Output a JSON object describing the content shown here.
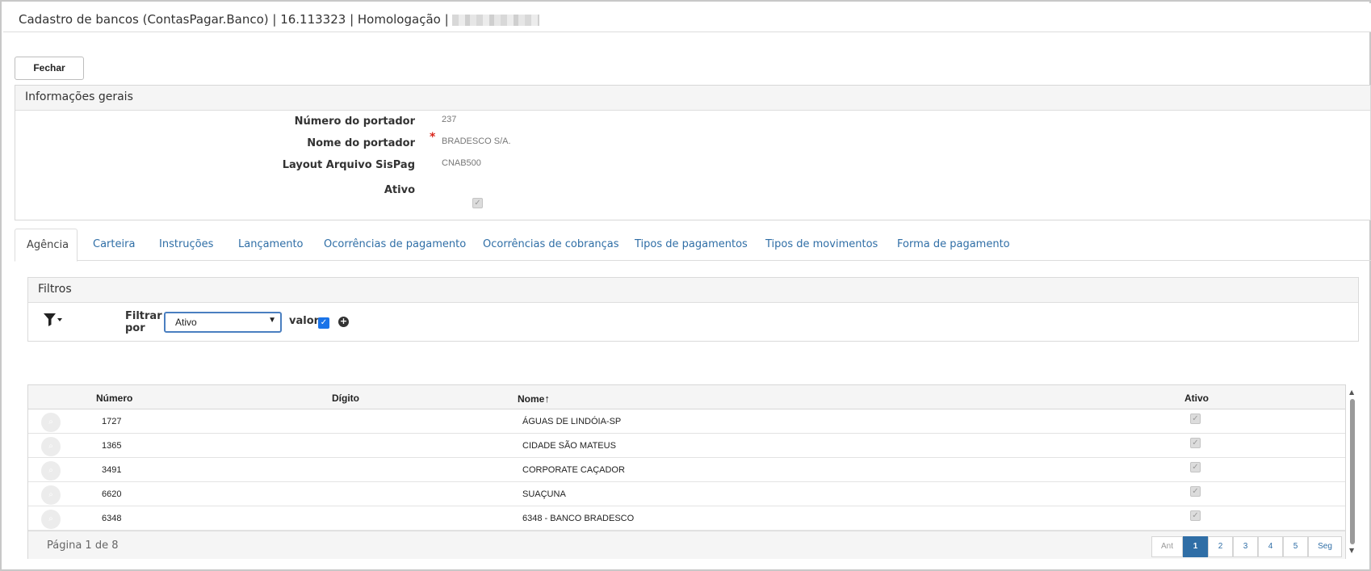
{
  "window": {
    "title": "Cadastro de bancos (ContasPagar.Banco) | 16.113323 | Homologação |"
  },
  "toolbar": {
    "close_label": "Fechar"
  },
  "general": {
    "header": "Informações gerais",
    "fields": {
      "numero_label": "Número do portador",
      "numero_value": "237",
      "nome_label": "Nome do portador",
      "nome_value": "BRADESCO S/A.",
      "layout_label": "Layout Arquivo SisPag",
      "layout_value": "CNAB500",
      "ativo_label": "Ativo",
      "ativo_checked": true
    },
    "required_mark": "*"
  },
  "tabs": [
    {
      "label": "Agência",
      "active": true
    },
    {
      "label": "Carteira"
    },
    {
      "label": "Instruções"
    },
    {
      "label": "Lançamento"
    },
    {
      "label": "Ocorrências de pagamento"
    },
    {
      "label": "Ocorrências de cobranças"
    },
    {
      "label": "Tipos de pagamentos"
    },
    {
      "label": "Tipos de movimentos"
    },
    {
      "label": "Forma de pagamento"
    }
  ],
  "filters": {
    "header": "Filtros",
    "filter_by_label": "Filtrar por",
    "selected_field": "Ativo",
    "value_label": "valor",
    "value_checked": true
  },
  "grid": {
    "columns": [
      "Número",
      "Dígito",
      "Nome",
      "Ativo"
    ],
    "sorted_column": "Nome",
    "sort_direction": "asc",
    "rows": [
      {
        "numero": "1727",
        "digito": "",
        "nome": "ÁGUAS DE LINDÓIA-SP",
        "ativo": true
      },
      {
        "numero": "1365",
        "digito": "",
        "nome": "CIDADE SÃO MATEUS",
        "ativo": true
      },
      {
        "numero": "3491",
        "digito": "",
        "nome": "CORPORATE CAÇADOR",
        "ativo": true
      },
      {
        "numero": "6620",
        "digito": "",
        "nome": "SUAÇUNA",
        "ativo": true
      },
      {
        "numero": "6348",
        "digito": "",
        "nome": "6348 - BANCO BRADESCO",
        "ativo": true
      }
    ]
  },
  "pagination": {
    "info": "Página 1 de 8",
    "prev": "Ant",
    "pages": [
      "1",
      "2",
      "3",
      "4",
      "5"
    ],
    "current": "1",
    "next": "Seg"
  },
  "colors": {
    "link": "#2f6ea6",
    "required": "#d9261c",
    "active_page": "#2f6ea6",
    "checkbox_blue": "#1a73e8"
  }
}
